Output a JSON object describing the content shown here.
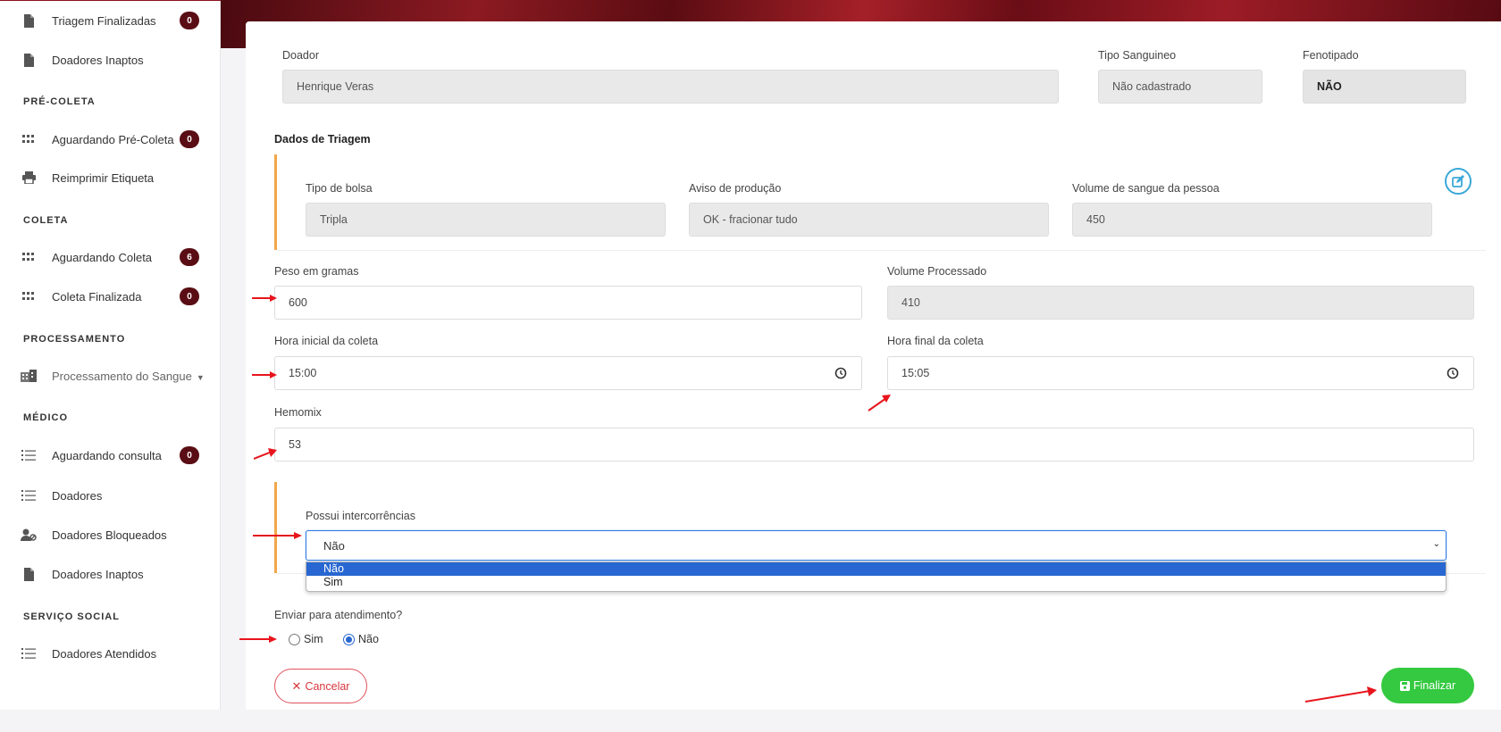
{
  "sidebar": {
    "items": [
      {
        "label": "Triagem Finalizadas",
        "badge": "0",
        "icon": "file-icon"
      },
      {
        "label": "Doadores Inaptos",
        "icon": "file-icon"
      },
      {
        "label": "Aguardando Pré-Coleta",
        "badge": "0",
        "icon": "grid-icon"
      },
      {
        "label": "Reimprimir Etiqueta",
        "icon": "printer-icon"
      },
      {
        "label": "Aguardando Coleta",
        "badge": "6",
        "icon": "grid-icon"
      },
      {
        "label": "Coleta Finalizada",
        "badge": "0",
        "icon": "grid-icon"
      },
      {
        "label": "Processamento do Sangue",
        "icon": "building-icon"
      },
      {
        "label": "Aguardando consulta",
        "badge": "0",
        "icon": "list-icon"
      },
      {
        "label": "Doadores",
        "icon": "list-icon"
      },
      {
        "label": "Doadores Bloqueados",
        "icon": "user-block-icon"
      },
      {
        "label": "Doadores Inaptos",
        "icon": "file-icon"
      },
      {
        "label": "Doadores Atendidos",
        "icon": "list-icon"
      }
    ],
    "headers": [
      "PRÉ-COLETA",
      "COLETA",
      "PROCESSAMENTO",
      "MÉDICO",
      "SERVIÇO SOCIAL"
    ]
  },
  "form": {
    "doador_label": "Doador",
    "doador_value": "Henrique Veras",
    "tipo_label": "Tipo Sanguineo",
    "tipo_value": "Não cadastrado",
    "fenotipado_label": "Fenotipado",
    "fenotipado_value": "NÃO",
    "dados_triagem_title": "Dados de Triagem",
    "tipo_bolsa_label": "Tipo de bolsa",
    "tipo_bolsa_value": "Tripla",
    "aviso_label": "Aviso de produção",
    "aviso_value": "OK - fracionar tudo",
    "volume_sangue_label": "Volume de sangue da pessoa",
    "volume_sangue_value": "450",
    "peso_label": "Peso em gramas",
    "peso_value": "600",
    "volume_proc_label": "Volume Processado",
    "volume_proc_value": "410",
    "hora_ini_label": "Hora inicial da coleta",
    "hora_ini_value": "15:00",
    "hora_fim_label": "Hora final da coleta",
    "hora_fim_value": "15:05",
    "hemomix_label": "Hemomix",
    "hemomix_value": "53",
    "intercorrencias_label": "Possui intercorrências",
    "intercorrencias_value": "Não",
    "intercorrencias_options": [
      "Não",
      "Sim"
    ],
    "enviar_label": "Enviar para atendimento?",
    "radio_sim": "Sim",
    "radio_nao": "Não",
    "radio_selected": "Não",
    "cancel_label": "Cancelar",
    "finalizar_label": "Finalizar"
  },
  "colors": {
    "accent_red": "#5a0d14",
    "section_bar": "#f2a64b",
    "primary_blue": "#2867d1",
    "success_green": "#34c940",
    "danger": "#d9363e",
    "annotation_arrow": "#e8141c"
  }
}
